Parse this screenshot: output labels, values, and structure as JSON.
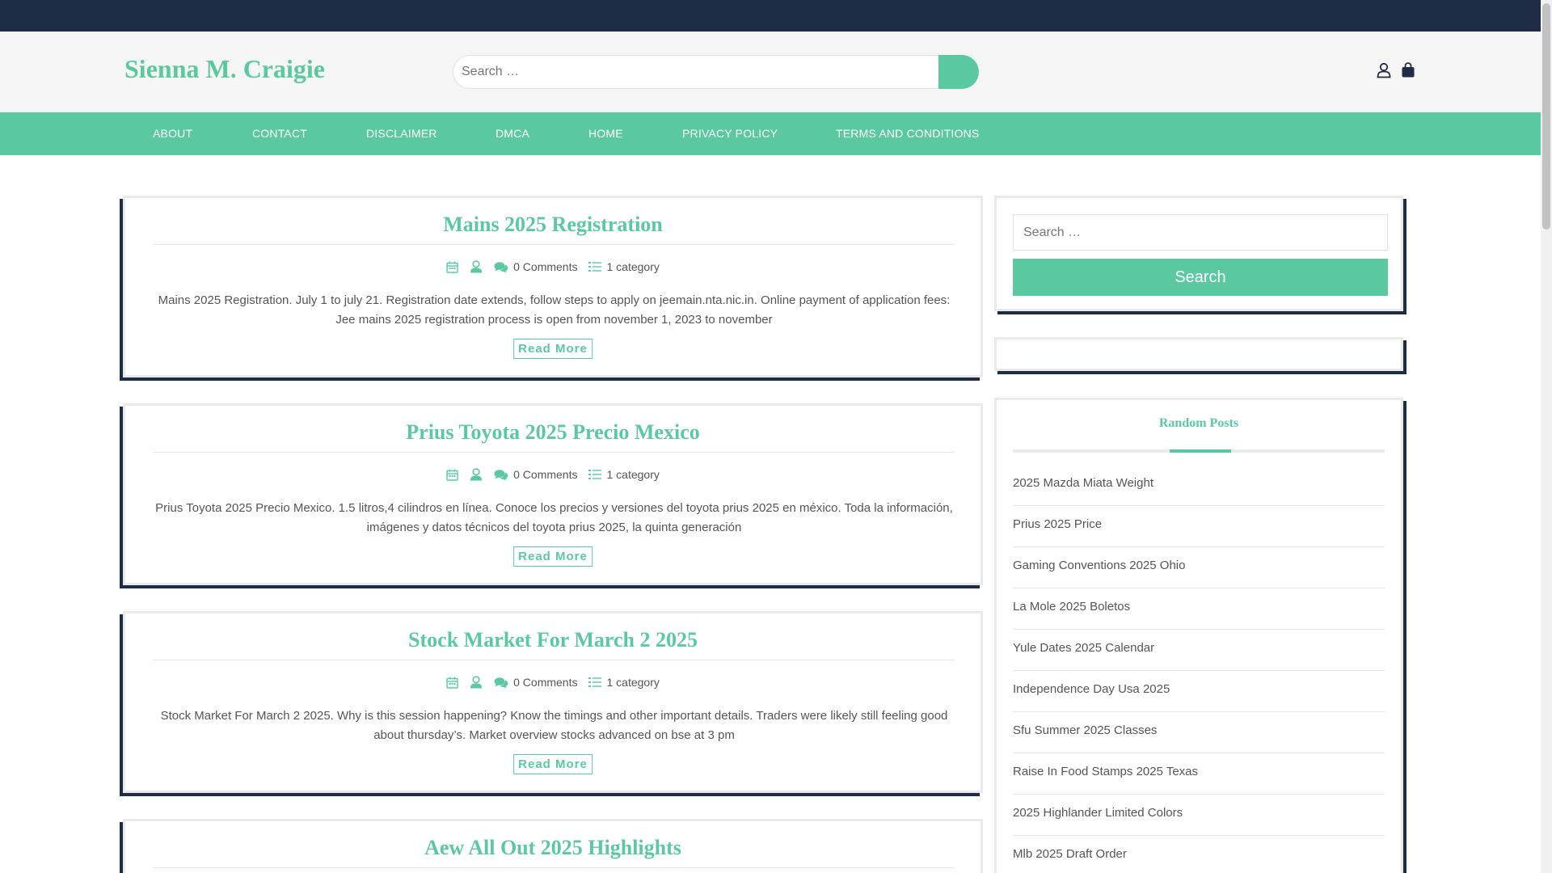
{
  "header": {
    "site_title": "Sienna M. Craigie",
    "search_placeholder": "Search …"
  },
  "nav": {
    "items": [
      {
        "label": "ABOUT"
      },
      {
        "label": "CONTACT"
      },
      {
        "label": "DISCLAIMER"
      },
      {
        "label": "DMCA"
      },
      {
        "label": "HOME"
      },
      {
        "label": "PRIVACY POLICY"
      },
      {
        "label": "TERMS AND CONDITIONS"
      }
    ]
  },
  "posts": [
    {
      "title": "Mains 2025 Registration",
      "comments": "0 Comments",
      "category": "1 category",
      "excerpt": "Mains 2025 Registration. July 1 to july 21. Registration date extends, follow steps to apply on jeemain.nta.nic.in. Online payment of application fees: Jee mains 2025 registration process is open from november 1, 2023 to november",
      "read_more": "Read More"
    },
    {
      "title": "Prius Toyota 2025 Precio Mexico",
      "comments": "0 Comments",
      "category": "1 category",
      "excerpt": "Prius Toyota 2025 Precio Mexico. 1.5 litros,4 cilindros en línea. Conoce los precios y versiones del toyota prius 2025 en méxico. Toda la información, imágenes y datos técnicos del toyota prius 2025, la quinta generación",
      "read_more": "Read More"
    },
    {
      "title": "Stock Market For March 2 2025",
      "comments": "0 Comments",
      "category": "1 category",
      "excerpt": "Stock Market For March 2 2025. Why is this session happening? Know the timings and other important details. Traders were likely still feeling good about thursday’s. Market overview stocks advanced on bse at 3 pm",
      "read_more": "Read More"
    },
    {
      "title": "Aew All Out 2025 Highlights"
    }
  ],
  "sidebar": {
    "search_placeholder": "Search …",
    "search_button": "Search",
    "random_posts_heading": "Random Posts",
    "random_posts": [
      "2025 Mazda Miata Weight",
      "Prius 2025 Price",
      "Gaming Conventions 2025 Ohio",
      "La Mole 2025 Boletos",
      "Yule Dates 2025 Calendar",
      "Independence Day Usa 2025",
      "Sfu Summer 2025 Classes",
      "Raise In Food Stamps 2025 Texas",
      "2025 Highlander Limited Colors",
      "Mlb 2025 Draft Order"
    ]
  },
  "colors": {
    "accent": "#5bc9a0",
    "dark": "#1e2d45",
    "header_bg": "#f5f5f5"
  }
}
